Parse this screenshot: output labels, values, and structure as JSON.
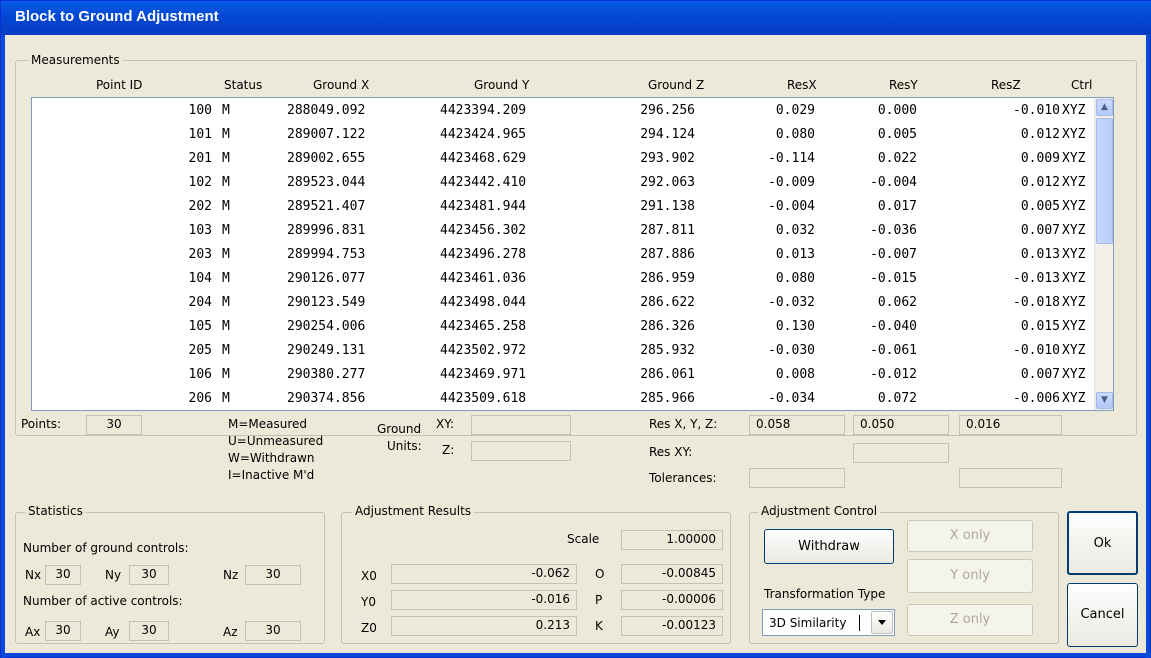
{
  "window": {
    "title": "Block to Ground Adjustment"
  },
  "measurements": {
    "group_label": "Measurements",
    "columns": [
      "Point ID",
      "Status",
      "Ground X",
      "Ground Y",
      "Ground Z",
      "ResX",
      "ResY",
      "ResZ",
      "Ctrl"
    ],
    "rows": [
      [
        "100",
        "M",
        "288049.092",
        "4423394.209",
        "296.256",
        "0.029",
        "0.000",
        "-0.010",
        "XYZ"
      ],
      [
        "101",
        "M",
        "289007.122",
        "4423424.965",
        "294.124",
        "0.080",
        "0.005",
        "0.012",
        "XYZ"
      ],
      [
        "201",
        "M",
        "289002.655",
        "4423468.629",
        "293.902",
        "-0.114",
        "0.022",
        "0.009",
        "XYZ"
      ],
      [
        "102",
        "M",
        "289523.044",
        "4423442.410",
        "292.063",
        "-0.009",
        "-0.004",
        "0.012",
        "XYZ"
      ],
      [
        "202",
        "M",
        "289521.407",
        "4423481.944",
        "291.138",
        "-0.004",
        "0.017",
        "0.005",
        "XYZ"
      ],
      [
        "103",
        "M",
        "289996.831",
        "4423456.302",
        "287.811",
        "0.032",
        "-0.036",
        "0.007",
        "XYZ"
      ],
      [
        "203",
        "M",
        "289994.753",
        "4423496.278",
        "287.886",
        "0.013",
        "-0.007",
        "0.013",
        "XYZ"
      ],
      [
        "104",
        "M",
        "290126.077",
        "4423461.036",
        "286.959",
        "0.080",
        "-0.015",
        "-0.013",
        "XYZ"
      ],
      [
        "204",
        "M",
        "290123.549",
        "4423498.044",
        "286.622",
        "-0.032",
        "0.062",
        "-0.018",
        "XYZ"
      ],
      [
        "105",
        "M",
        "290254.006",
        "4423465.258",
        "286.326",
        "0.130",
        "-0.040",
        "0.015",
        "XYZ"
      ],
      [
        "205",
        "M",
        "290249.131",
        "4423502.972",
        "285.932",
        "-0.030",
        "-0.061",
        "-0.010",
        "XYZ"
      ],
      [
        "106",
        "M",
        "290380.277",
        "4423469.971",
        "286.061",
        "0.008",
        "-0.012",
        "0.007",
        "XYZ"
      ],
      [
        "206",
        "M",
        "290374.856",
        "4423509.618",
        "285.966",
        "-0.034",
        "0.072",
        "-0.006",
        "XYZ"
      ]
    ],
    "points_label": "Points:",
    "points_value": "30",
    "legend": [
      "M=Measured",
      "U=Unmeasured",
      "W=Withdrawn",
      "I=Inactive M'd"
    ],
    "ground_units_label_1": "Ground",
    "ground_units_label_2": "Units:",
    "xy_label": "XY:",
    "z_label": "Z:",
    "xy_value": "",
    "z_value": "",
    "res_xyz_label": "Res X, Y, Z:",
    "res_x": "0.058",
    "res_y": "0.050",
    "res_z": "0.016",
    "res_xy_label": "Res XY:",
    "res_xy_value": "",
    "tolerances_label": "Tolerances:",
    "tol_xy": "",
    "tol_z": ""
  },
  "statistics": {
    "group_label": "Statistics",
    "ground_controls_label": "Number of ground controls:",
    "nx_label": "Nx",
    "nx": "30",
    "ny_label": "Ny",
    "ny": "30",
    "nz_label": "Nz",
    "nz": "30",
    "active_controls_label": "Number of active controls:",
    "ax_label": "Ax",
    "ax": "30",
    "ay_label": "Ay",
    "ay": "30",
    "az_label": "Az",
    "az": "30"
  },
  "results": {
    "group_label": "Adjustment Results",
    "scale_label": "Scale",
    "scale": "1.00000",
    "x0_label": "X0",
    "x0": "-0.062",
    "y0_label": "Y0",
    "y0": "-0.016",
    "z0_label": "Z0",
    "z0": "0.213",
    "o_label": "O",
    "o": "-0.00845",
    "p_label": "P",
    "p": "-0.00006",
    "k_label": "K",
    "k": "-0.00123"
  },
  "control": {
    "group_label": "Adjustment Control",
    "withdraw": "Withdraw",
    "x_only": "X only",
    "y_only": "Y only",
    "z_only": "Z only",
    "transformation_label": "Transformation Type",
    "transformation_value": "3D Similarity"
  },
  "buttons": {
    "ok": "Ok",
    "cancel": "Cancel"
  },
  "icons": {
    "scroll_up": "chevron-up-icon",
    "scroll_down": "chevron-down-icon",
    "dropdown": "triangle-down-icon"
  }
}
